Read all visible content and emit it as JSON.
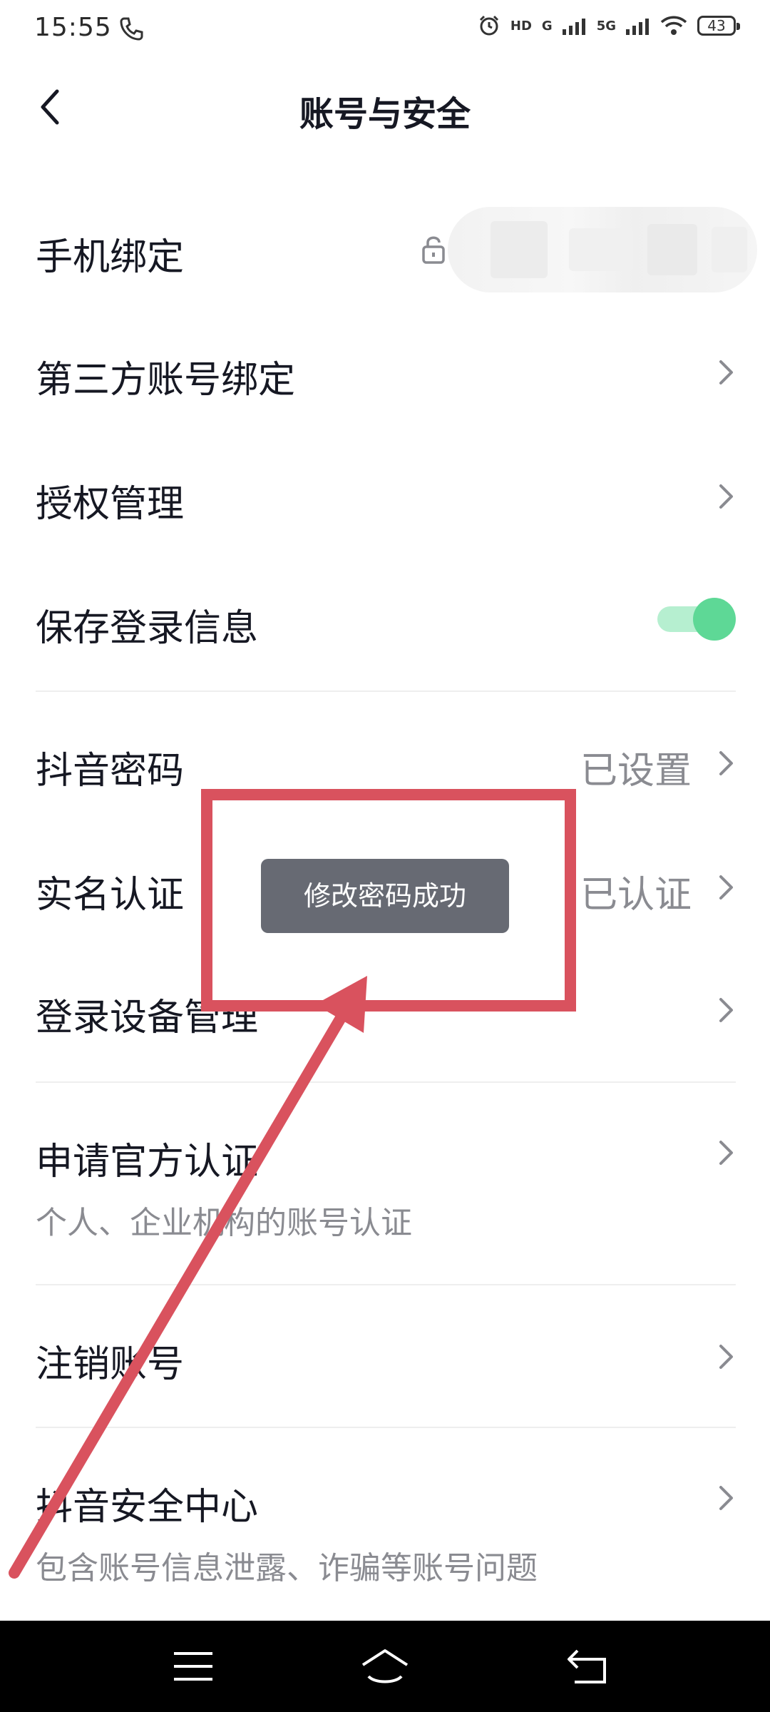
{
  "status_bar": {
    "time": "15:55",
    "network_labels": [
      "HD",
      "G",
      "5G"
    ],
    "battery": "43"
  },
  "nav": {
    "title": "账号与安全"
  },
  "rows": {
    "phone_binding": {
      "label": "手机绑定"
    },
    "third_party": {
      "label": "第三方账号绑定"
    },
    "authorization": {
      "label": "授权管理"
    },
    "save_login": {
      "label": "保存登录信息",
      "enabled": true
    },
    "password": {
      "label": "抖音密码",
      "value": "已设置"
    },
    "real_name": {
      "label": "实名认证",
      "value": "已认证"
    },
    "devices": {
      "label": "登录设备管理"
    },
    "official": {
      "label": "申请官方认证",
      "sub": "个人、企业机构的账号认证"
    },
    "cancel_account": {
      "label": "注销账号"
    },
    "security_center": {
      "label": "抖音安全中心",
      "sub": "包含账号信息泄露、诈骗等账号问题"
    }
  },
  "toast": {
    "text": "修改密码成功"
  },
  "colors": {
    "toggle_on": "#5ed896",
    "annotation": "#d9525e",
    "toast_bg": "#676a73"
  },
  "icons": {
    "back": "chevron-left-icon",
    "row_arrow": "chevron-right-icon",
    "lock": "lock-icon",
    "menu": "menu-icon",
    "home": "home-icon",
    "return": "return-icon"
  }
}
